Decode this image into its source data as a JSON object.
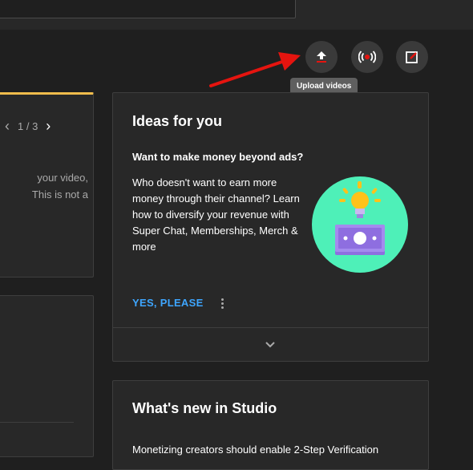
{
  "header": {
    "tooltip": "Upload videos",
    "buttons": [
      {
        "name": "upload-icon"
      },
      {
        "name": "go-live-icon"
      },
      {
        "name": "create-post-icon"
      }
    ]
  },
  "left_card": {
    "pager": "1 / 3",
    "text_lines": [
      "your video,",
      "This is not a"
    ]
  },
  "ideas": {
    "title": "Ideas for you",
    "subtitle": "Want to make money beyond ads?",
    "body": "Who doesn't want to earn more money through their channel? Learn how to diversify your revenue with Super Chat, Memberships, Merch & more",
    "action_label": "YES, PLEASE"
  },
  "whats_new": {
    "title": "What's new in Studio",
    "text": "Monetizing creators should enable 2-Step Verification"
  },
  "colors": {
    "accent_blue": "#3ea6ff",
    "card_top_accent": "#f0bc4c",
    "arrow_red": "#e5140f"
  }
}
